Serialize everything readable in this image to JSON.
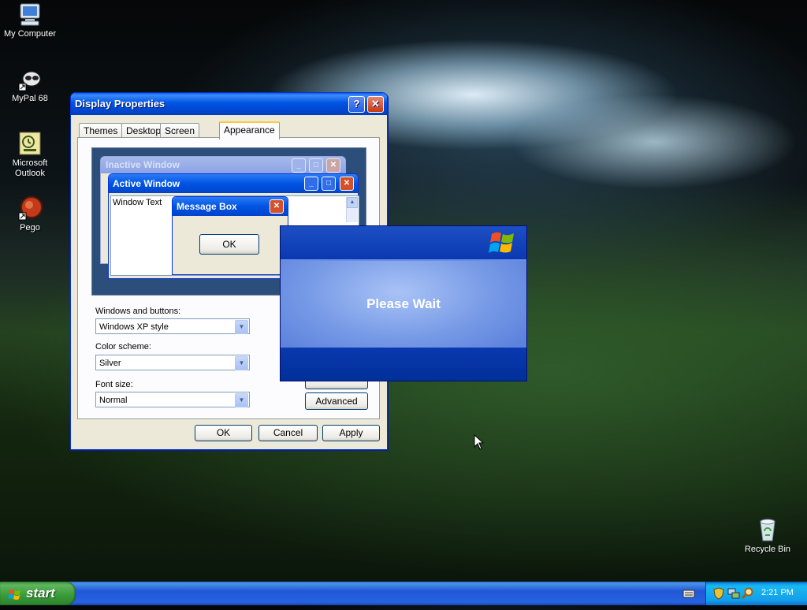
{
  "desktop": {
    "icons": [
      {
        "label": "My Computer",
        "icon": "my-computer-icon"
      },
      {
        "label": "MyPal 68",
        "icon": "mypal-icon"
      },
      {
        "label": "Microsoft Outlook",
        "icon": "outlook-icon"
      },
      {
        "label": "Pego",
        "icon": "pego-icon"
      },
      {
        "label": "Recycle Bin",
        "icon": "recycle-bin-icon"
      }
    ]
  },
  "display_properties": {
    "title": "Display Properties",
    "tabs": [
      "Themes",
      "Desktop",
      "Screen Saver",
      "Appearance"
    ],
    "active_tab": "Appearance",
    "preview": {
      "inactive_title": "Inactive Window",
      "active_title": "Active Window",
      "window_text": "Window Text",
      "message_box_title": "Message Box",
      "message_box_ok": "OK"
    },
    "windows_and_buttons": {
      "label": "Windows and buttons:",
      "value": "Windows XP style"
    },
    "color_scheme": {
      "label": "Color scheme:",
      "value": "Silver"
    },
    "font_size": {
      "label": "Font size:",
      "value": "Normal"
    },
    "advanced_label": "Advanced",
    "buttons": {
      "ok": "OK",
      "cancel": "Cancel",
      "apply": "Apply"
    }
  },
  "please_wait": {
    "message": "Please Wait"
  },
  "taskbar": {
    "start_label": "start",
    "clock": "2:21 PM"
  },
  "colors": {
    "titlebar_blue": "#0054e3",
    "window_face": "#ece9d8",
    "taskbar_blue": "#2157d7",
    "start_green": "#379a37"
  }
}
